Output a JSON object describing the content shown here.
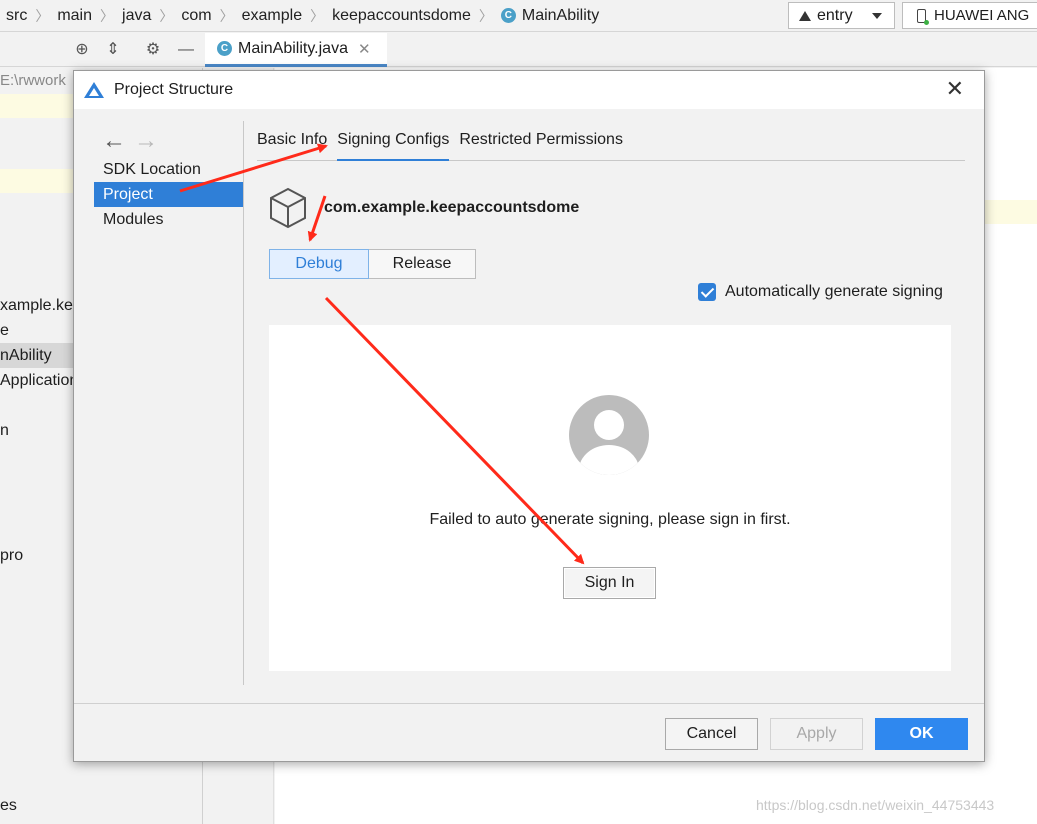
{
  "breadcrumb": [
    "src",
    "main",
    "java",
    "com",
    "example",
    "keepaccountsdome",
    "MainAbility"
  ],
  "breadcrumb_class_badge": "C",
  "run_config": {
    "module": "entry",
    "device": "HUAWEI ANG"
  },
  "editor": {
    "file_tab": "MainAbility.java",
    "file_tab_close": "✕",
    "file_badge": "C"
  },
  "project_panel": {
    "path": "E:\\rwwork",
    "rows": [
      "xample.kee",
      "e",
      "nAbility",
      "Application",
      "n",
      "pro",
      "es"
    ]
  },
  "dialog": {
    "title": "Project Structure",
    "close": "✕",
    "nav_back": "←",
    "nav_forward": "→",
    "nav_items": [
      "SDK Location",
      "Project",
      "Modules"
    ],
    "active_nav": "Project",
    "tabs": [
      "Basic Info",
      "Signing Configs",
      "Restricted Permissions"
    ],
    "active_tab": "Signing Configs",
    "package_name": "com.example.keepaccountsdome",
    "build_types": [
      "Debug",
      "Release"
    ],
    "active_build_type": "Debug",
    "auto_sign_label": "Automatically generate signing",
    "auto_sign_checked": true,
    "fail_message": "Failed to auto generate signing, please sign in first.",
    "sign_in_label": "Sign In",
    "buttons": {
      "cancel": "Cancel",
      "apply": "Apply",
      "ok": "OK"
    }
  },
  "watermark": "https://blog.csdn.net/weixin_44753443",
  "colors": {
    "accent": "#2f7fd7",
    "ok_button": "#2f88ef",
    "annotation_arrow": "#ff2a1a",
    "class_badge": "#4ba0c8"
  }
}
